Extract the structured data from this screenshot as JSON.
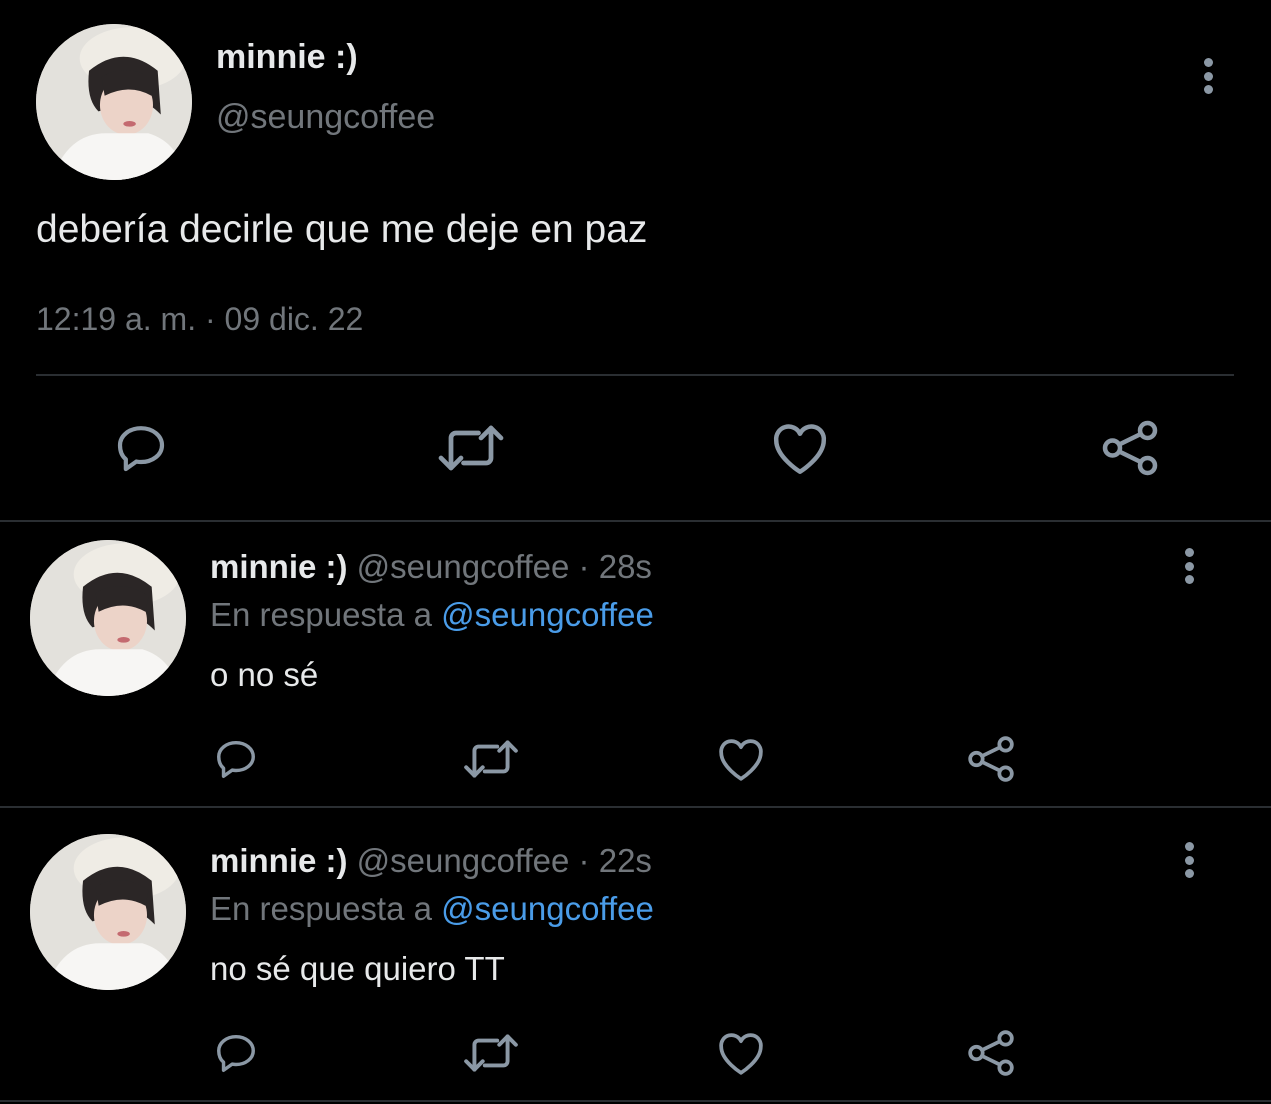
{
  "main_tweet": {
    "display_name": "minnie :)",
    "handle": "@seungcoffee",
    "text": "debería decirle que me deje en paz",
    "timestamp": "12:19 a. m. · 09 dic. 22"
  },
  "replies": [
    {
      "display_name": "minnie :)",
      "meta": "@seungcoffee · 28s",
      "reply_prefix": "En respuesta a",
      "reply_to": "@seungcoffee",
      "text": "o no sé"
    },
    {
      "display_name": "minnie :)",
      "meta": "@seungcoffee · 22s",
      "reply_prefix": "En respuesta a",
      "reply_to": "@seungcoffee",
      "text": "no sé que quiero TT"
    }
  ],
  "icons": {
    "reply": "speech-bubble",
    "retweet": "retweet-arrows",
    "like": "heart-outline",
    "share": "share-nodes",
    "more": "vertical-dots"
  },
  "colors": {
    "background": "#000000",
    "text": "#e7e9ea",
    "secondary": "#71767b",
    "link": "#4a9ce8",
    "icon": "#8b98a5"
  }
}
